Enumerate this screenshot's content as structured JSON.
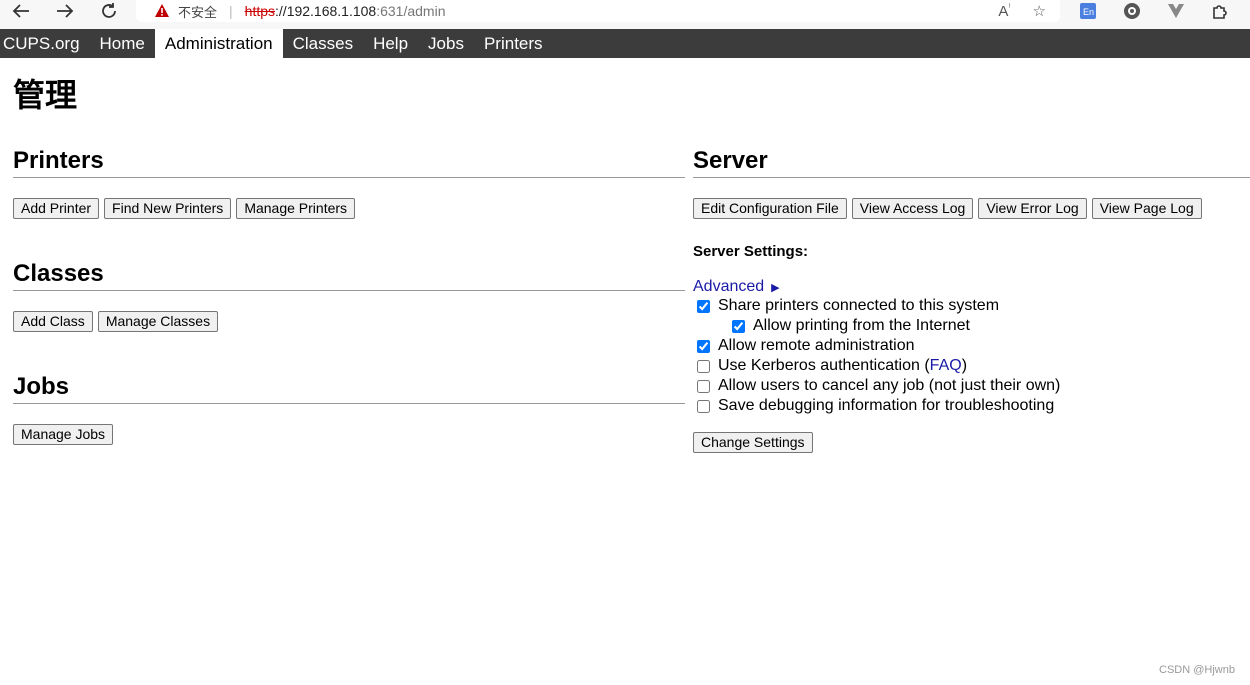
{
  "browser": {
    "insecure_label": "不安全",
    "url_scheme": "https",
    "url_sep": "://",
    "url_host": "192.168.1.108",
    "url_path": ":631/admin"
  },
  "nav": {
    "items": [
      "CUPS.org",
      "Home",
      "Administration",
      "Classes",
      "Help",
      "Jobs",
      "Printers"
    ],
    "active": "Administration"
  },
  "page": {
    "title": "管理"
  },
  "printers": {
    "heading": "Printers",
    "buttons": [
      "Add Printer",
      "Find New Printers",
      "Manage Printers"
    ]
  },
  "classes": {
    "heading": "Classes",
    "buttons": [
      "Add Class",
      "Manage Classes"
    ]
  },
  "jobs": {
    "heading": "Jobs",
    "buttons": [
      "Manage Jobs"
    ]
  },
  "server": {
    "heading": "Server",
    "buttons": [
      "Edit Configuration File",
      "View Access Log",
      "View Error Log",
      "View Page Log"
    ],
    "settings_title": "Server Settings:",
    "advanced_label": "Advanced",
    "options": [
      {
        "label": "Share printers connected to this system",
        "checked": true
      },
      {
        "label": "Allow printing from the Internet",
        "checked": true
      },
      {
        "label": "Allow remote administration",
        "checked": true
      },
      {
        "label": "Use Kerberos authentication (",
        "link": "FAQ",
        "suffix": ")",
        "checked": false
      },
      {
        "label": "Allow users to cancel any job (not just their own)",
        "checked": false
      },
      {
        "label": "Save debugging information for troubleshooting",
        "checked": false
      }
    ],
    "change_button": "Change Settings"
  },
  "watermark": "CSDN @Hjwnb",
  "icons": {
    "back": "arrow-left-icon",
    "forward": "arrow-right-icon",
    "reload": "reload-icon",
    "warning": "warning-icon"
  },
  "colors": {
    "navbar": "#3c3c3c",
    "link": "#1a1aa6",
    "warning": "#c00000"
  }
}
